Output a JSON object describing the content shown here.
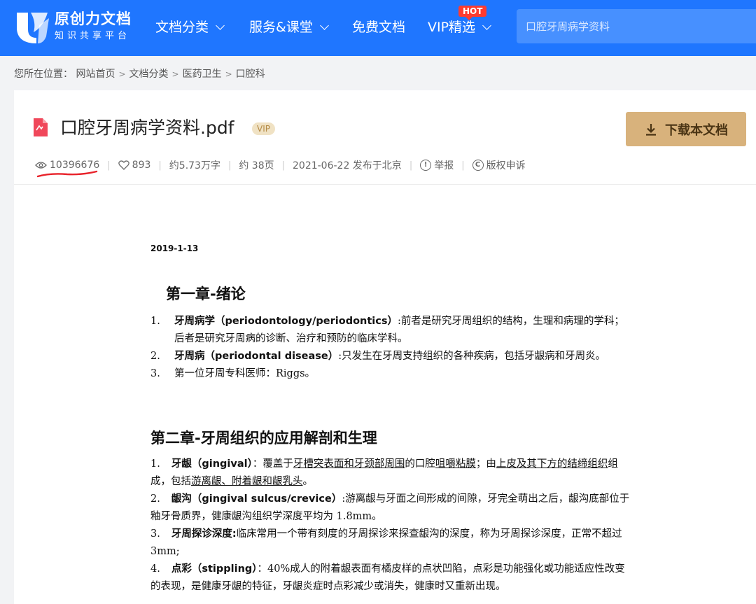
{
  "header": {
    "brand_main": "原创力文档",
    "brand_sub": "知识共享平台",
    "nav": [
      {
        "label": "文档分类"
      },
      {
        "label": "服务&课堂"
      },
      {
        "label": "免费文档"
      },
      {
        "label": "VIP精选"
      }
    ],
    "hot_badge": "HOT",
    "search_placeholder": "口腔牙周病学资料",
    "brand_color": "#1f76ff"
  },
  "breadcrumb": {
    "prefix": "您所在位置：",
    "items": [
      "网站首页",
      "文档分类",
      "医药卫生",
      "口腔科"
    ],
    "separator": ">"
  },
  "document": {
    "title": "口腔牙周病学资料.pdf",
    "vip_tag": "VIP",
    "download_label": "下载本文档",
    "meta": {
      "views": "10396676",
      "likes": "893",
      "words": "约5.73万字",
      "pages": "约 38页",
      "published": "2021-06-22 发布于北京",
      "report": "举报",
      "copyright": "版权申诉"
    },
    "accent_color": "#d8b27c"
  },
  "content": {
    "date": "2019-1-13",
    "chapter1": {
      "title": "第一章-绪论",
      "items": [
        {
          "num": "1.",
          "term": "牙周病学（periodontology/periodontics）",
          "text": ":前者是研究牙周组织的结构，生理和病理的学科；后者是研究牙周病的诊断、治疗和预防的临床学科。"
        },
        {
          "num": "2.",
          "term": "牙周病（periodontal disease）",
          "text": ":只发生在牙周支持组织的各种疾病，包括牙龈病和牙周炎。"
        },
        {
          "num": "3.",
          "term": "",
          "text": "第一位牙周专科医师：Riggs。"
        }
      ]
    },
    "chapter2": {
      "title": "第二章-牙周组织的应用解剖和生理",
      "items": [
        {
          "num": "1.",
          "term": "牙龈（gingival）",
          "text_a": "：覆盖于",
          "text_u1": "牙槽突表面和牙颈部周围",
          "text_b": "的口腔",
          "text_u2": "咀嚼粘膜",
          "text_c": "；由",
          "text_u3": "上皮及其下方的结缔组织",
          "text_d": "组成，包括",
          "text_u4": "游离龈、附着龈和龈乳头",
          "text_e": "。"
        },
        {
          "num": "2.",
          "term": "龈沟（gingival sulcus/crevice）",
          "text": ":游离龈与牙面之间形成的间隙，牙完全萌出之后，龈沟底部位于釉牙骨质界，健康龈沟组织学深度平均为 1.8mm。"
        },
        {
          "num": "3.",
          "term": "牙周探诊深度:",
          "text": "临床常用一个带有刻度的牙周探诊来探查龈沟的深度，称为牙周探诊深度，正常不超过 3mm;"
        },
        {
          "num": "4.",
          "term": "点彩（stippling）",
          "text": "：40%成人的附着龈表面有橘皮样的点状凹陷，点彩是功能强化或功能适应性改变的表现，是健康牙龈的特征，牙龈炎症时点彩减少或消失，健康时又重新出现。"
        }
      ]
    }
  }
}
